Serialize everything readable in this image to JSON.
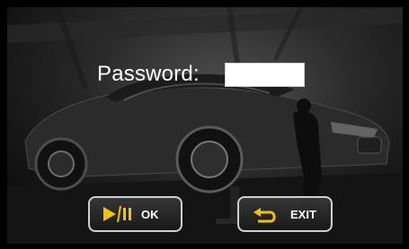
{
  "password_label": "Password:",
  "password_value": "",
  "buttons": {
    "ok": {
      "label": "OK",
      "icon": "play-pause-icon"
    },
    "exit": {
      "label": "EXIT",
      "icon": "return-arrow-icon"
    }
  },
  "colors": {
    "icon_yellow": "#f2c200",
    "button_border": "#cfcfcf",
    "text": "#ffffff"
  }
}
